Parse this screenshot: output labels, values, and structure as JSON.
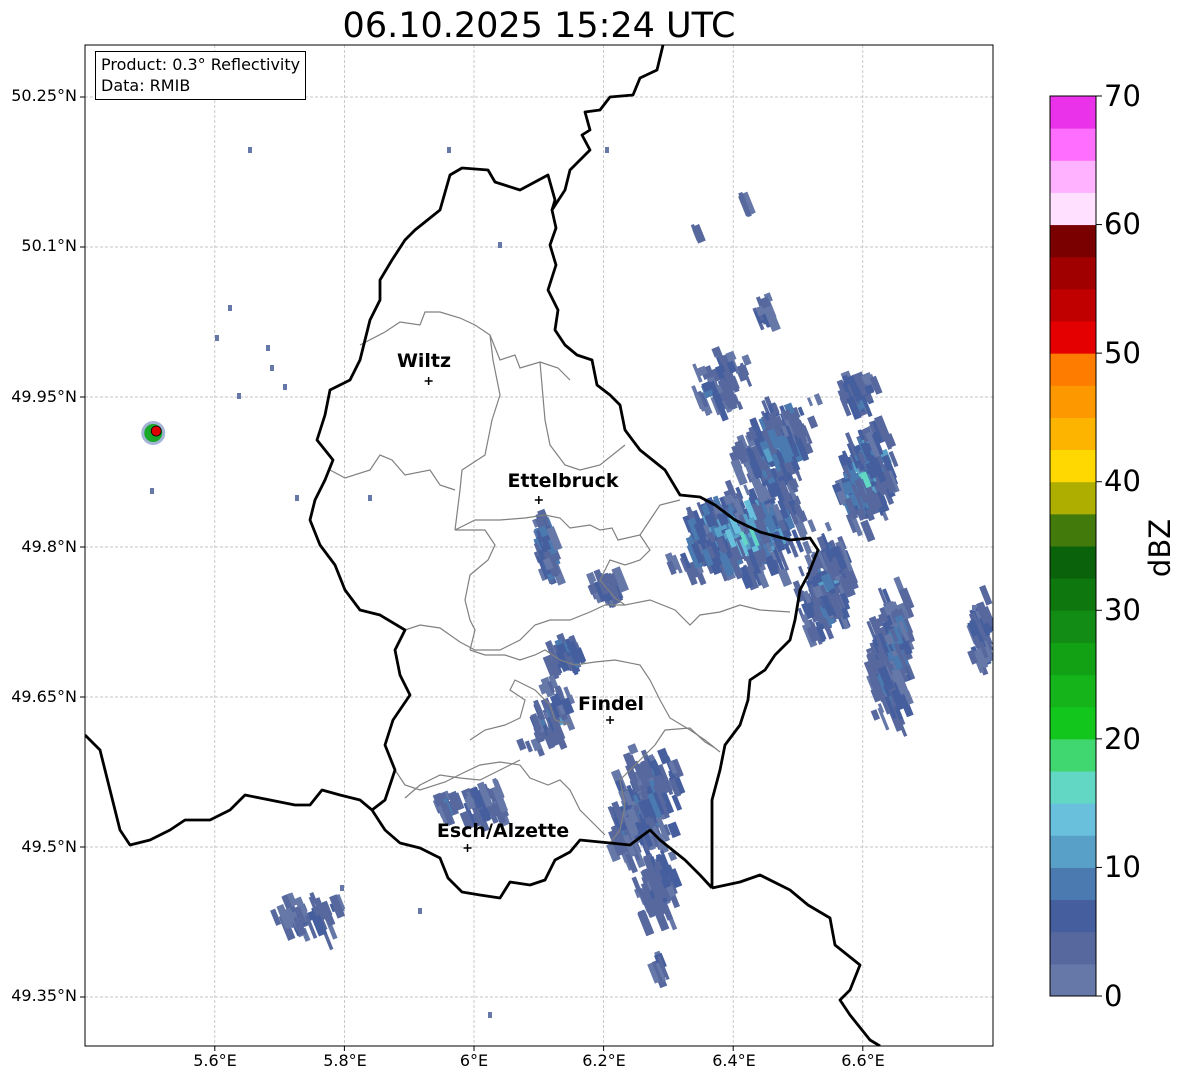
{
  "title": "06.10.2025 15:24 UTC",
  "info": {
    "product": "Product: 0.3° Reflectivity",
    "data_source": "Data: RMIB"
  },
  "axes": {
    "lon_ticks": [
      "5.6°E",
      "5.8°E",
      "6°E",
      "6.2°E",
      "6.4°E",
      "6.6°E"
    ],
    "lat_ticks": [
      "50.25°N",
      "50.1°N",
      "49.95°N",
      "49.8°N",
      "49.65°N",
      "49.5°N",
      "49.35°N"
    ]
  },
  "cities": [
    {
      "name": "Wiltz",
      "lon": 5.93,
      "lat": 49.966
    },
    {
      "name": "Ettelbruck",
      "lon": 6.1,
      "lat": 49.847
    },
    {
      "name": "Findel",
      "lon": 6.21,
      "lat": 49.627
    },
    {
      "name": "Esch/Alzette",
      "lon": 5.99,
      "lat": 49.499
    }
  ],
  "colorbar": {
    "unit": "dBZ",
    "tick_labels": [
      "0",
      "10",
      "20",
      "30",
      "40",
      "50",
      "60",
      "70"
    ],
    "min": 0,
    "max": 70,
    "colors": [
      "#6678a8",
      "#56689e",
      "#445e9e",
      "#4a7ab0",
      "#58a0c8",
      "#68c0dc",
      "#62d8c4",
      "#40d670",
      "#12c61c",
      "#14b41a",
      "#12a014",
      "#128c14",
      "#0e780e",
      "#0a620a",
      "#437a0c",
      "#adae00",
      "#fed800",
      "#fcb400",
      "#fe9800",
      "#fe7c00",
      "#e40000",
      "#c00000",
      "#a00000",
      "#7a0000",
      "#ffe0ff",
      "#ffb2ff",
      "#ff6eff",
      "#ea32ea"
    ]
  },
  "radar_site": {
    "lon": 5.505,
    "lat": 49.914
  }
}
